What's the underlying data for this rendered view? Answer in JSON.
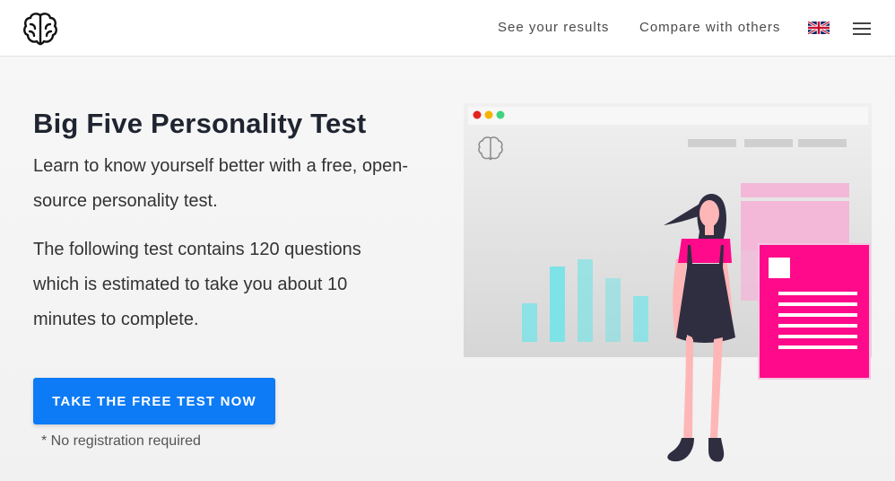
{
  "header": {
    "logo_icon": "brain-icon",
    "nav": {
      "results": "See your results",
      "compare": "Compare with others"
    },
    "language_icon": "uk-flag-icon",
    "menu_icon": "hamburger-menu-icon"
  },
  "hero": {
    "title": "Big Five Personality Test",
    "lead": "Learn to know yourself better with a free, open-source personality test.",
    "description": "The following test contains 120 questions which is estimated to take you about 10 minutes to complete.",
    "cta_label": "TAKE THE FREE TEST NOW",
    "note": "* No registration required"
  },
  "colors": {
    "accent": "#0d7bf6",
    "pink": "#ff0a8a",
    "bar_teal": "#7ee3e6"
  }
}
